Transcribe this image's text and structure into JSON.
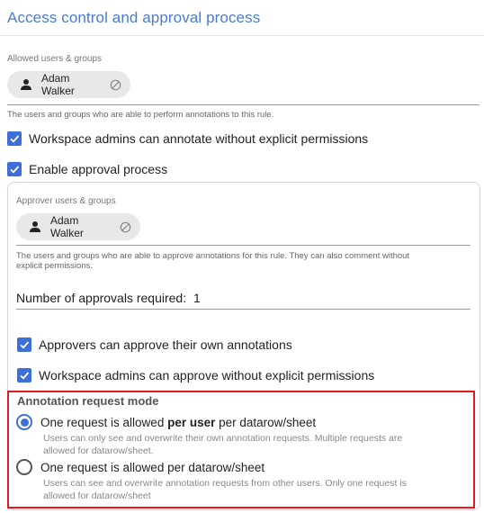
{
  "section_title": "Access control and approval process",
  "allowed": {
    "label": "Allowed users & groups",
    "chip_name": "Adam Walker",
    "helper": "The users and groups who are able to perform annotations to this rule."
  },
  "workspace_admins_annotate": {
    "label": "Workspace admins can annotate without explicit permissions",
    "checked": true
  },
  "enable_approval": {
    "label": "Enable approval process",
    "checked": true
  },
  "approvers": {
    "label": "Approver users & groups",
    "chip_name": "Adam Walker",
    "helper_line1": "The users and groups who are able to approve annotations for this rule. They can also comment without",
    "helper_line2": "explicit permissions."
  },
  "approvals_required": {
    "label": "Number of approvals required:",
    "value": "1"
  },
  "approvers_own": {
    "label": "Approvers can approve their own annotations",
    "checked": true
  },
  "admins_approve": {
    "label": "Workspace admins can approve without explicit permissions",
    "checked": true
  },
  "request_mode": {
    "title": "Annotation request mode",
    "option1": {
      "label_pre": "One request is allowed ",
      "label_bold": "per user",
      "label_post": " per datarow/sheet",
      "desc_line1": "Users can only see and overwrite their own annotation requests. Multiple requests are",
      "desc_line2": "allowed for datarow/sheet.",
      "selected": true
    },
    "option2": {
      "label": "One request is allowed per datarow/sheet",
      "desc_line1": "Users can see and overwrite annotation requests from other users. Only one request is",
      "desc_line2": "allowed for datarow/sheet",
      "selected": false
    }
  },
  "colors": {
    "accent": "#3e6fd9",
    "title_blue": "#4a7bd0",
    "highlight_red": "#e5191f"
  },
  "icons": {
    "chip_person": "person-icon",
    "chip_remove": "remove-icon",
    "checkbox": "check-icon"
  }
}
